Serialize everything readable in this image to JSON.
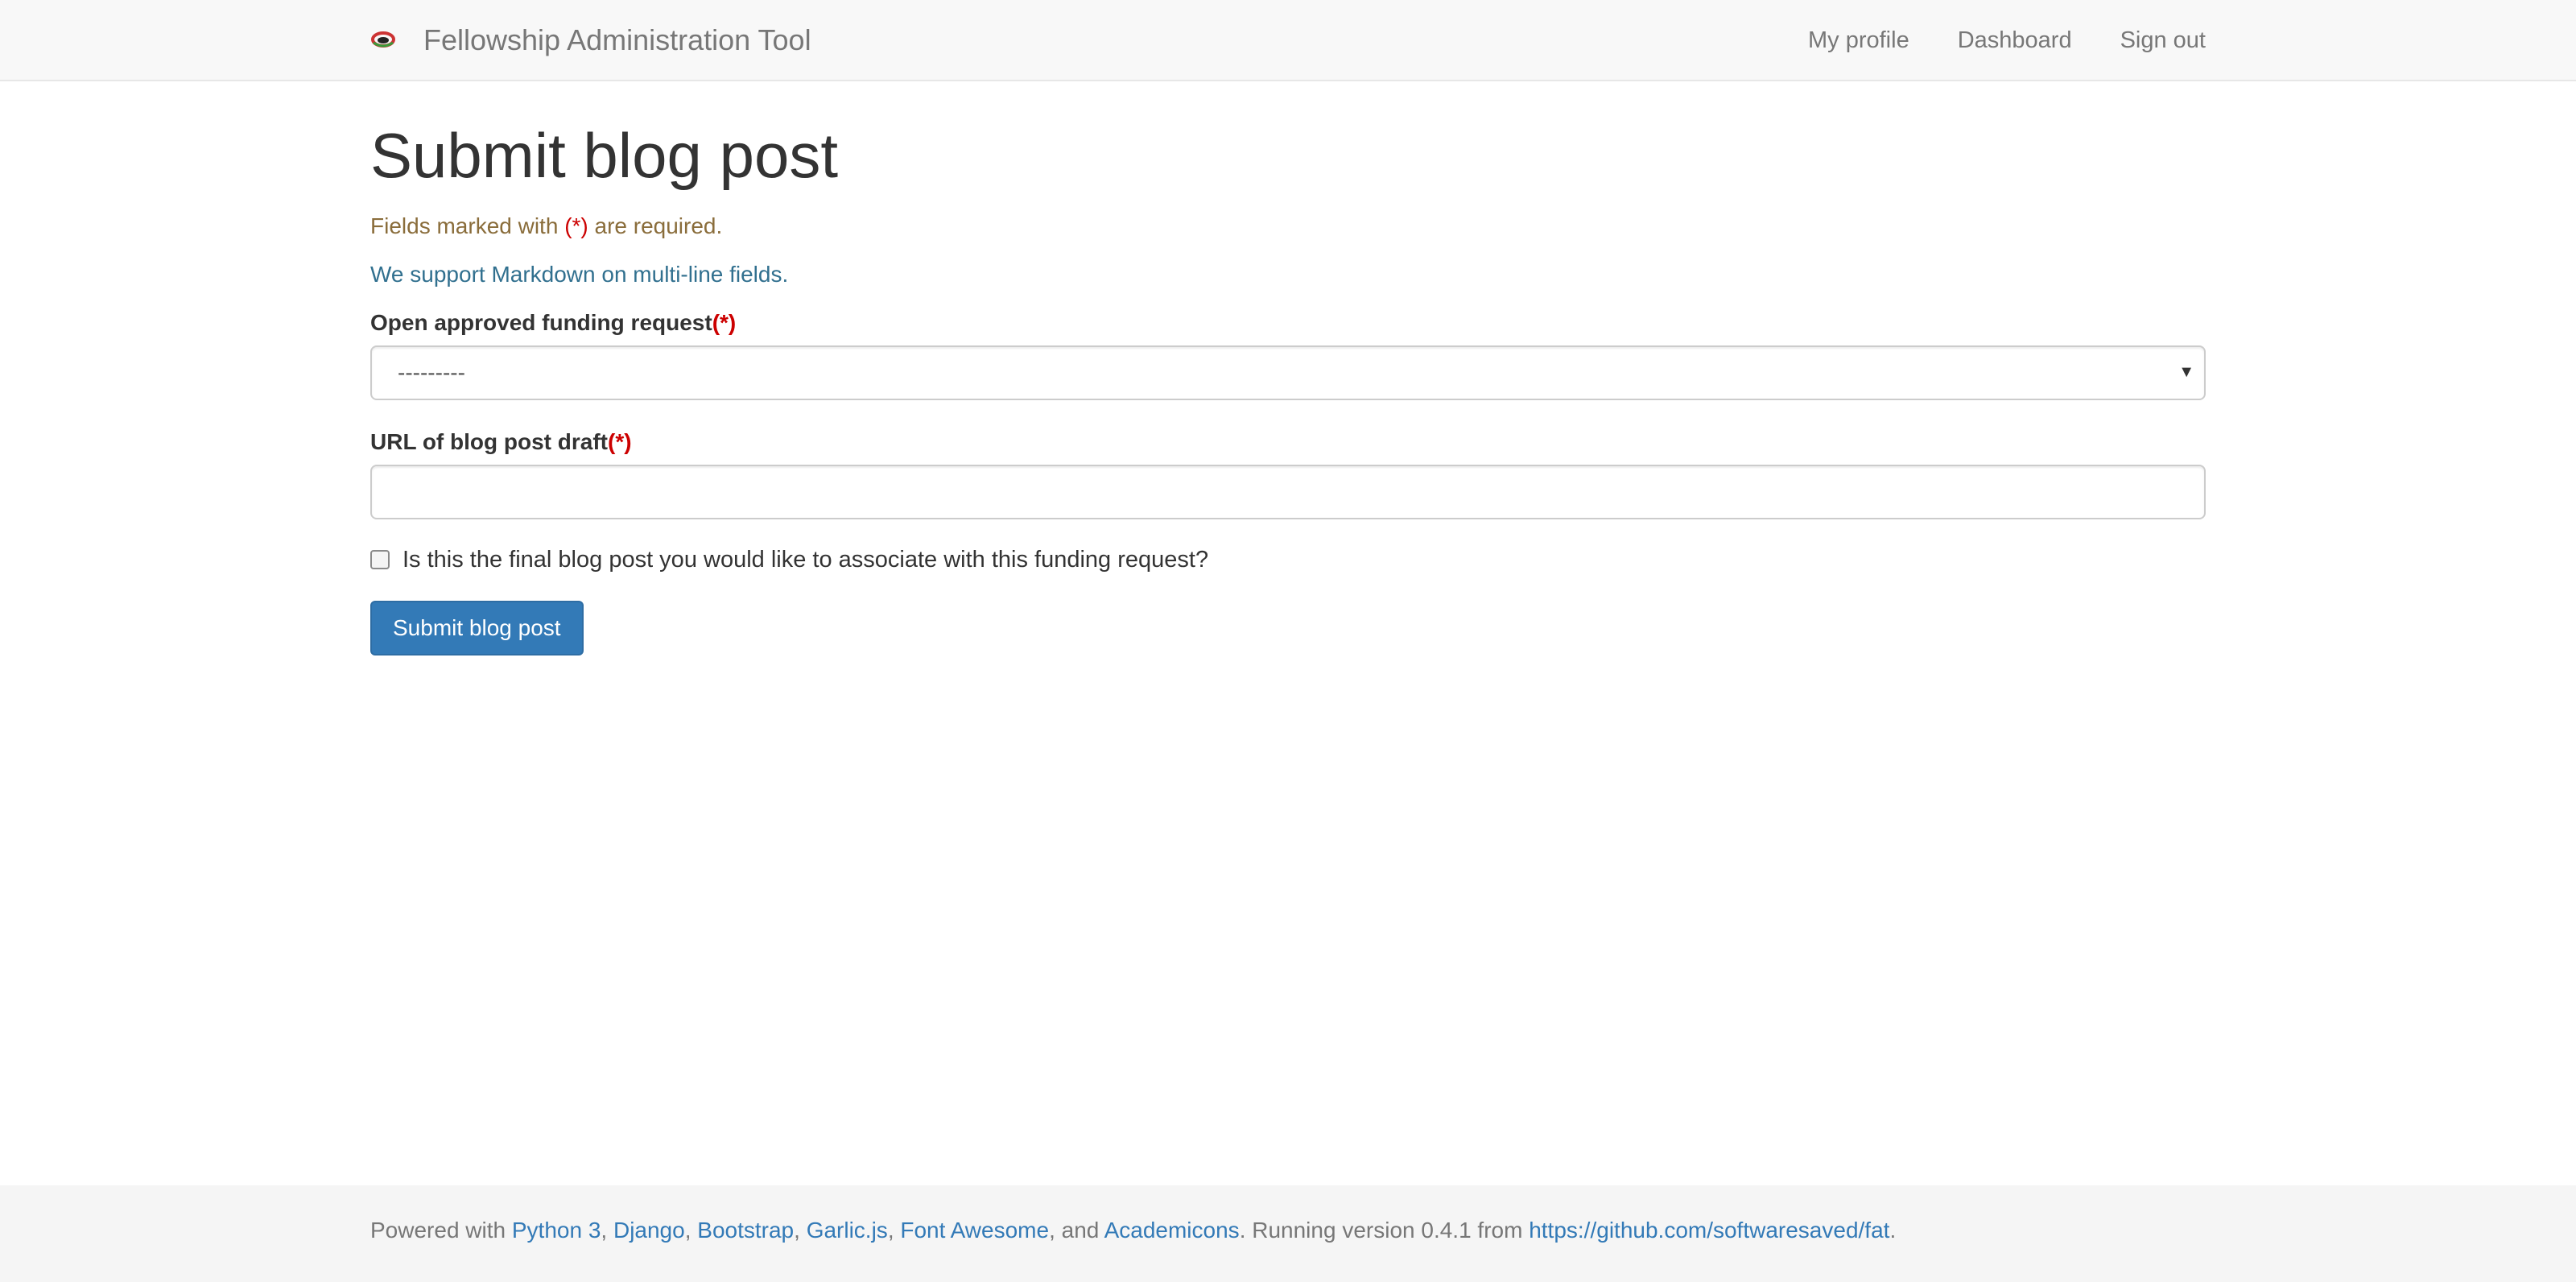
{
  "navbar": {
    "brand": "Fellowship Administration Tool",
    "links": [
      "My profile",
      "Dashboard",
      "Sign out"
    ]
  },
  "page": {
    "title": "Submit blog post",
    "required_note_before": "Fields marked with ",
    "required_marker": "(*)",
    "required_note_after": " are required.",
    "markdown_note": "We support Markdown on multi-line fields."
  },
  "form": {
    "funding_label": "Open approved funding request",
    "funding_selected": "---------",
    "url_label": "URL of blog post draft",
    "url_value": "",
    "final_checkbox_label": "Is this the final blog post you would like to associate with this funding request?",
    "final_checked": false,
    "submit_label": "Submit blog post"
  },
  "footer": {
    "prefix": "Powered with ",
    "links": [
      "Python 3",
      "Django",
      "Bootstrap",
      "Garlic.js",
      "Font Awesome",
      "Academicons"
    ],
    "sep1": ", ",
    "sep2": ", ",
    "sep3": ", ",
    "sep4": ", ",
    "sep5": ", and ",
    "running": ". Running version 0.4.1 from ",
    "repo": "https://github.com/softwaresaved/fat",
    "suffix": "."
  },
  "colors": {
    "primary": "#337ab7",
    "required": "#cc0000",
    "warning_text": "#8a6d3b",
    "info_text": "#31708f"
  },
  "icons": {
    "brand_logo": "fellowship-logo-icon",
    "select_caret": "caret-down-icon"
  }
}
